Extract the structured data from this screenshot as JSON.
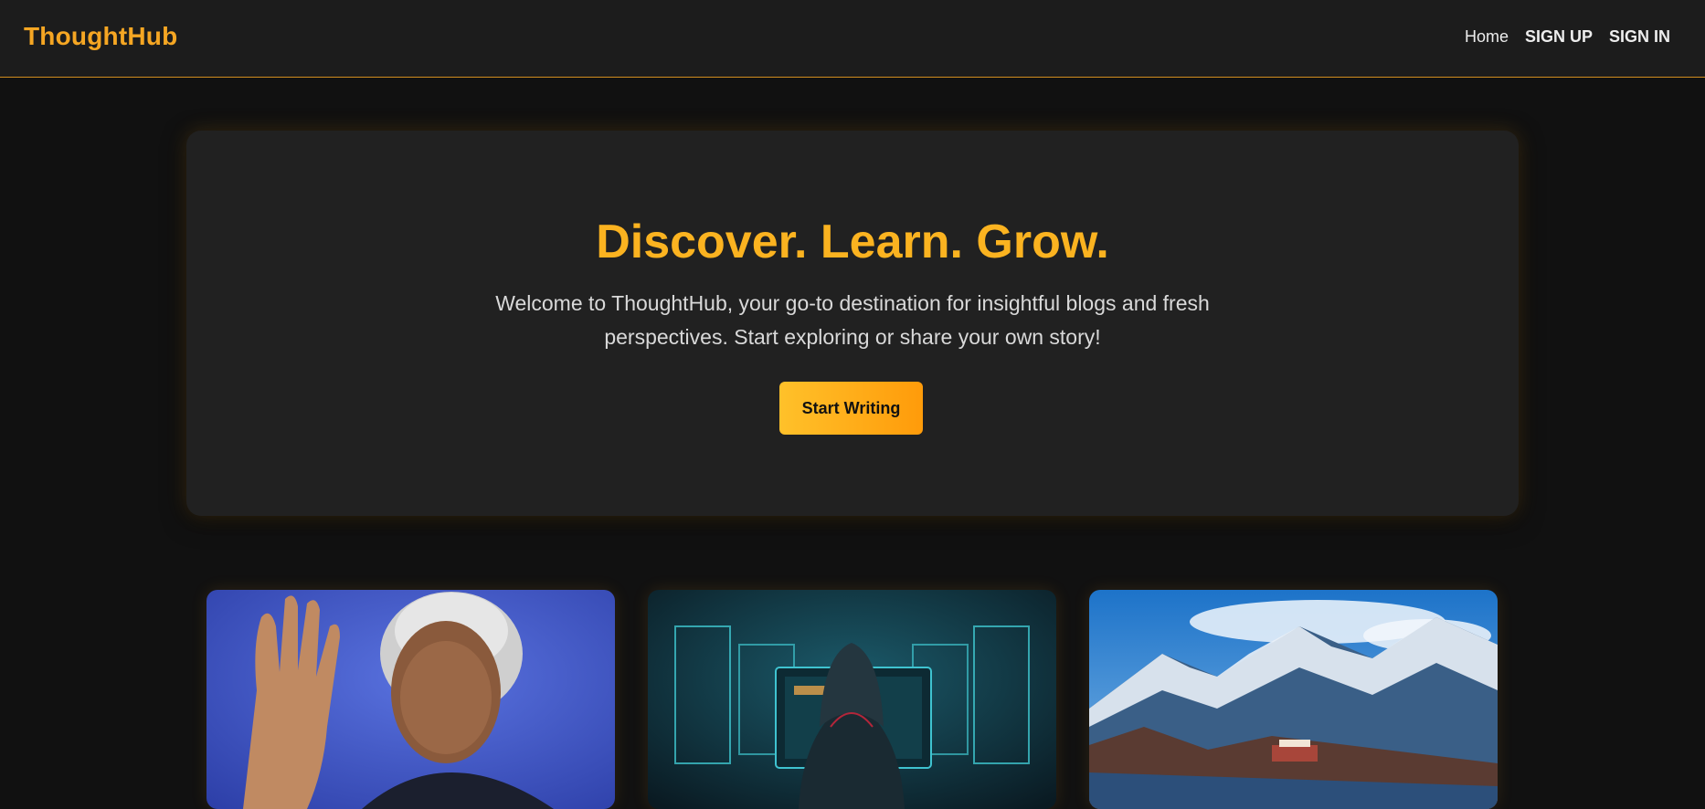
{
  "navbar": {
    "brand": "ThoughtHub",
    "links": [
      {
        "label": "Home"
      },
      {
        "label": "SIGN UP"
      },
      {
        "label": "SIGN IN"
      }
    ]
  },
  "hero": {
    "title": "Discover. Learn. Grow.",
    "subtitle": "Welcome to ThoughtHub, your go-to destination for insightful blogs and fresh perspectives. Start exploring or share your own story!",
    "cta_label": "Start Writing"
  },
  "cards": [
    {
      "image": "portrait-waving-man"
    },
    {
      "image": "hooded-hacker-screens"
    },
    {
      "image": "snowy-mountain-landscape"
    }
  ],
  "colors": {
    "accent": "#f5a623",
    "background": "#111111",
    "navbar": "#1c1c1c",
    "hero_panel": "#212121"
  }
}
